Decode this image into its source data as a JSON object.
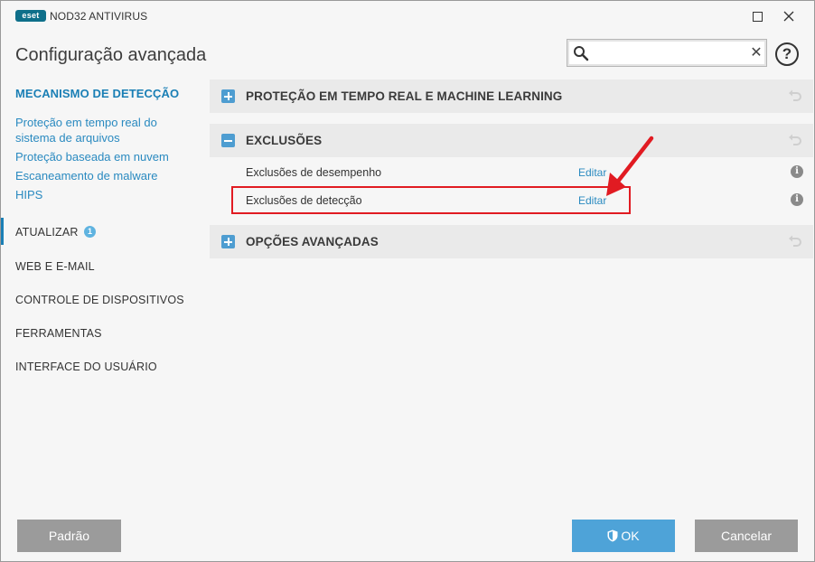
{
  "window": {
    "logo_text": "eset",
    "app_name": "NOD32 ANTIVIRUS",
    "maximize_icon": "maximize-icon",
    "close_icon": "close-icon"
  },
  "header": {
    "title": "Configuração avançada",
    "search": {
      "value": "",
      "placeholder": "",
      "clear_glyph": "✕"
    },
    "help_glyph": "?"
  },
  "sidebar": {
    "active_section": "MECANISMO DE DETECÇÃO",
    "sub_items": [
      "Proteção em tempo real do sistema de arquivos",
      "Proteção baseada em nuvem",
      "Escaneamento de malware",
      "HIPS"
    ],
    "items": [
      {
        "label": "ATUALIZAR",
        "badge": "1"
      },
      {
        "label": "WEB E E-MAIL"
      },
      {
        "label": "CONTROLE DE DISPOSITIVOS"
      },
      {
        "label": "FERRAMENTAS"
      },
      {
        "label": "INTERFACE DO USUÁRIO"
      }
    ]
  },
  "main": {
    "sections": [
      {
        "title": "PROTEÇÃO EM TEMPO REAL E MACHINE LEARNING",
        "expanded": false
      },
      {
        "title": "EXCLUSÕES",
        "expanded": true,
        "rows": [
          {
            "label": "Exclusões de desempenho",
            "action": "Editar"
          },
          {
            "label": "Exclusões de detecção",
            "action": "Editar"
          }
        ]
      },
      {
        "title": "OPÇÕES AVANÇADAS",
        "expanded": false
      }
    ],
    "info_glyph": "i"
  },
  "footer": {
    "default_label": "Padrão",
    "ok_label": "OK",
    "cancel_label": "Cancelar"
  },
  "colors": {
    "accent": "#1a7fb5",
    "link": "#2a8ac0",
    "ok_button": "#4ea3d8",
    "gray_button": "#9b9b9b",
    "annotation_red": "#e11b22"
  }
}
